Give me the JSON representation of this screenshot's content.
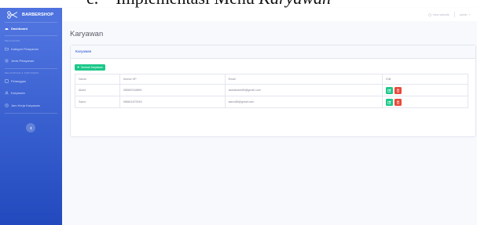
{
  "caption": {
    "number": "c.",
    "text": "Implementasi Menu ",
    "italic": "Karyawan"
  },
  "brand": {
    "name": "BARBERSHOP",
    "icon": "scissors-icon"
  },
  "sidebar": {
    "dashboard": {
      "label": "Dashboard",
      "icon": "tachometer-icon"
    },
    "heading1": "PELAYANAN",
    "items1": [
      {
        "label": "Kategori Pelayanan",
        "icon": "folder-icon"
      },
      {
        "label": "Jenis Pelayanan",
        "icon": "list-icon"
      }
    ],
    "heading2": "PELANGGAN & KARYAWAN",
    "items2": [
      {
        "label": "Pelanggan",
        "icon": "users-icon"
      },
      {
        "label": "Karyawan",
        "icon": "user-icon"
      },
      {
        "label": "Jam Kerja Karyawan",
        "icon": "clock-icon"
      }
    ]
  },
  "topbar": {
    "view_website": "View website",
    "user": "admin"
  },
  "page": {
    "title": "Karyawan"
  },
  "card": {
    "title": "Karyawan",
    "add_button": "Tambah Karyawan",
    "columns": [
      "Nama",
      "Nomor HP",
      "Email",
      "Edit"
    ],
    "rows": [
      {
        "nama": "Abdul",
        "hp": "085892348891",
        "email": "abdulwaris89@gmail.com"
      },
      {
        "nama": "Samo",
        "hp": "088811670043",
        "email": "samo88@gmail.com"
      }
    ]
  },
  "colors": {
    "sidebar": "#4e73df",
    "success": "#1cc88a",
    "danger": "#e74a3b",
    "bg": "#f8f9fc"
  }
}
